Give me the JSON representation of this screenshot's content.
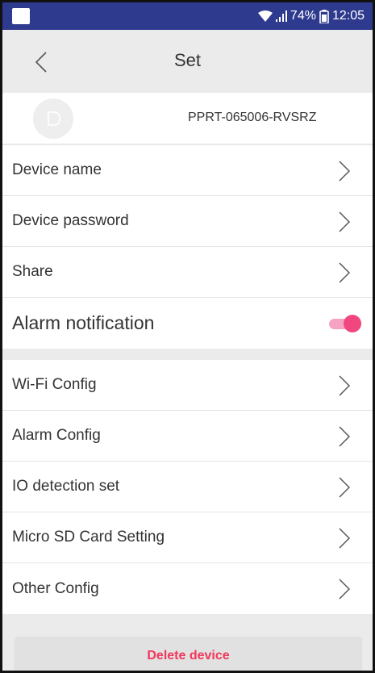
{
  "status_bar": {
    "battery": "74%",
    "time": "12:05"
  },
  "header": {
    "title": "Set"
  },
  "device": {
    "id": "PPRT-065006-RVSRZ"
  },
  "group1": [
    {
      "label": "Device name"
    },
    {
      "label": "Device password"
    },
    {
      "label": "Share"
    }
  ],
  "alarm_notification": {
    "label": "Alarm notification",
    "enabled": true
  },
  "group2": [
    {
      "label": "Wi-Fi Config"
    },
    {
      "label": "Alarm Config"
    },
    {
      "label": "IO detection set"
    },
    {
      "label": "Micro SD Card Setting"
    },
    {
      "label": "Other Config"
    }
  ],
  "delete_button": {
    "label": "Delete device"
  },
  "colors": {
    "status_bar": "#2e3a8e",
    "toggle_on": "#f2467f",
    "delete_text": "#f2365a"
  }
}
